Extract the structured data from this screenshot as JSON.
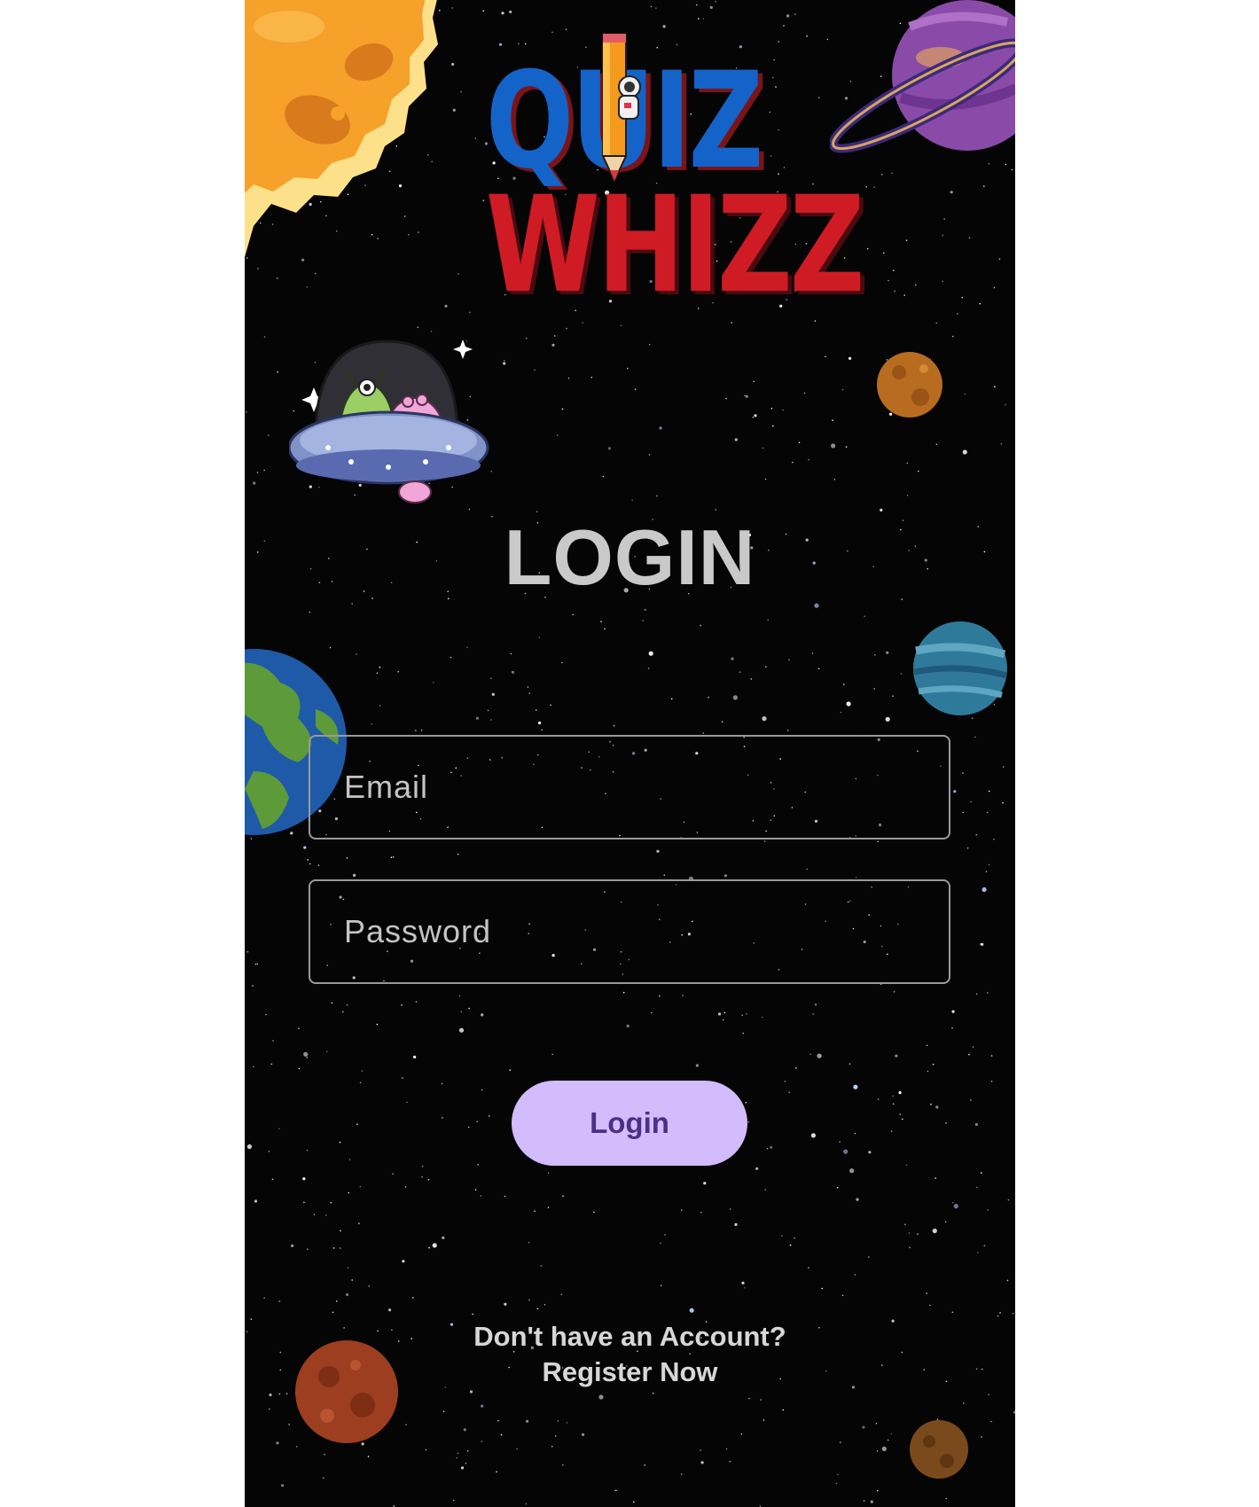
{
  "logo": {
    "line1": "QUIZ",
    "line2": "WHIZZ"
  },
  "screen": {
    "title": "LOGIN"
  },
  "form": {
    "email_placeholder": "Email",
    "password_placeholder": "Password",
    "login_label": "Login"
  },
  "footer": {
    "prompt": "Don't have an Account?",
    "register_label": "Register Now"
  },
  "colors": {
    "background": "#050506",
    "button": "#d3bcfb",
    "button_text": "#4b2f84",
    "logo_blue": "#1363c9",
    "logo_red": "#cf1b24"
  },
  "decorations": {
    "icons": [
      "sun-icon",
      "ringed-planet-icon",
      "ufo-aliens-icon",
      "earth-icon",
      "small-planet-icon",
      "striped-planet-icon",
      "mars-planet-icon",
      "brown-planet-icon",
      "pencil-astronaut-icon"
    ]
  }
}
